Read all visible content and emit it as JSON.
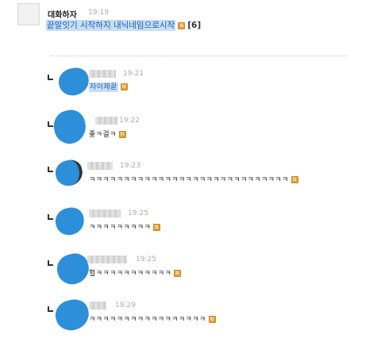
{
  "post": {
    "author": "대화하자",
    "time": "19:19",
    "text": "끝말잇기 시작하지 내닉네임으로시작",
    "badge": "N",
    "comment_count": "[6]"
  },
  "replies": [
    {
      "nick": "nickname",
      "time": "19:21",
      "text": "자이제끝",
      "highlight": true,
      "badge": "N"
    },
    {
      "nick": "nickname",
      "time": "19:22",
      "text": "좋ㅋ걸ㅋ",
      "highlight": false,
      "badge": "N"
    },
    {
      "nick": "nickname",
      "time": "19:23",
      "text": "ㅋㅋㅋㅋㅋㅋㅋㅋㅋㅋㅋㅋㅋㅋㅋㅋㅋㅋㅋㅋㅋㅋㅋㅋㅋㅋㅋㅋㅋ",
      "highlight": false,
      "badge": "N"
    },
    {
      "nick": "nickname",
      "time": "19:25",
      "text": "ㅋㅋㅋㅋㅋㅋㅋㅋㅋ",
      "highlight": false,
      "badge": "N"
    },
    {
      "nick": "nickname",
      "time": "19:25",
      "text": "헐ㅋㅋㅋㅋㅋㅋㅋㅋㅋㅋㅋ",
      "highlight": false,
      "badge": "N"
    },
    {
      "nick": "nickname",
      "time": "19:29",
      "text": "ㅋㅋㅋㅋㅋㅋㅋㅋㅋㅋㅋㅋㅋㅋㅋㅋㅋ",
      "highlight": false,
      "badge": "N"
    }
  ]
}
